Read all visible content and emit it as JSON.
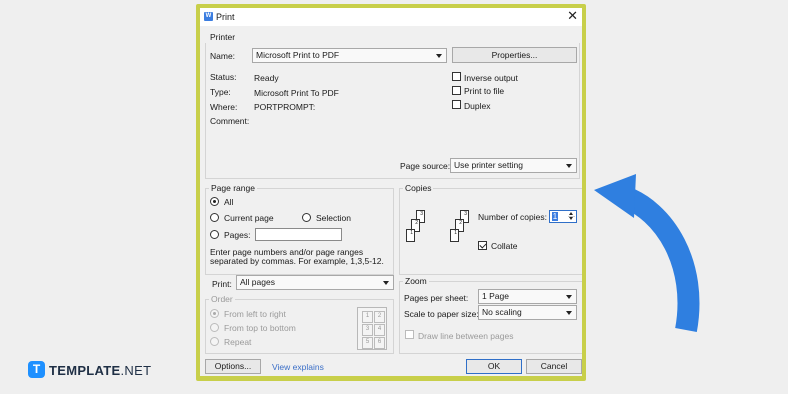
{
  "window": {
    "title": "Print",
    "app_icon": "W",
    "close_glyph": "✕"
  },
  "printer": {
    "legend": "Printer",
    "name_label": "Name:",
    "name_value": "Microsoft Print to PDF",
    "properties_button": "Properties...",
    "status_label": "Status:",
    "status_value": "Ready",
    "type_label": "Type:",
    "type_value": "Microsoft Print To PDF",
    "where_label": "Where:",
    "where_value": "PORTPROMPT:",
    "comment_label": "Comment:",
    "inverse_output": "Inverse output",
    "print_to_file": "Print to file",
    "duplex": "Duplex",
    "page_source_label": "Page source:",
    "page_source_value": "Use printer setting"
  },
  "page_range": {
    "legend": "Page range",
    "all": "All",
    "current_page": "Current page",
    "selection": "Selection",
    "pages": "Pages:",
    "pages_value": "",
    "hint_line1": "Enter page numbers and/or page ranges",
    "hint_line2": "separated by commas. For example, 1,3,5-12."
  },
  "copies": {
    "legend": "Copies",
    "number_label": "Number of copies:",
    "number_value": "1",
    "collate": "Collate",
    "page_digits": [
      "3",
      "2",
      "1"
    ]
  },
  "print_select": {
    "label": "Print:",
    "value": "All pages"
  },
  "order": {
    "legend": "Order",
    "left_to_right": "From left to right",
    "top_to_bottom": "From top to bottom",
    "repeat": "Repeat",
    "grid": [
      "1",
      "2",
      "3",
      "4",
      "5",
      "6"
    ]
  },
  "zoom": {
    "legend": "Zoom",
    "pages_per_sheet_label": "Pages per sheet:",
    "pages_per_sheet_value": "1 Page",
    "scale_label": "Scale to paper size:",
    "scale_value": "No scaling",
    "draw_line": "Draw line between pages"
  },
  "footer": {
    "options": "Options...",
    "view_explains": "View explains",
    "ok": "OK",
    "cancel": "Cancel"
  },
  "branding": {
    "logo_letter": "T",
    "name": "TEMPLATE",
    "suffix": ".NET"
  },
  "colors": {
    "frame": "#c8cf4a",
    "arrow": "#2f7fe0",
    "link": "#3b6fc7"
  }
}
